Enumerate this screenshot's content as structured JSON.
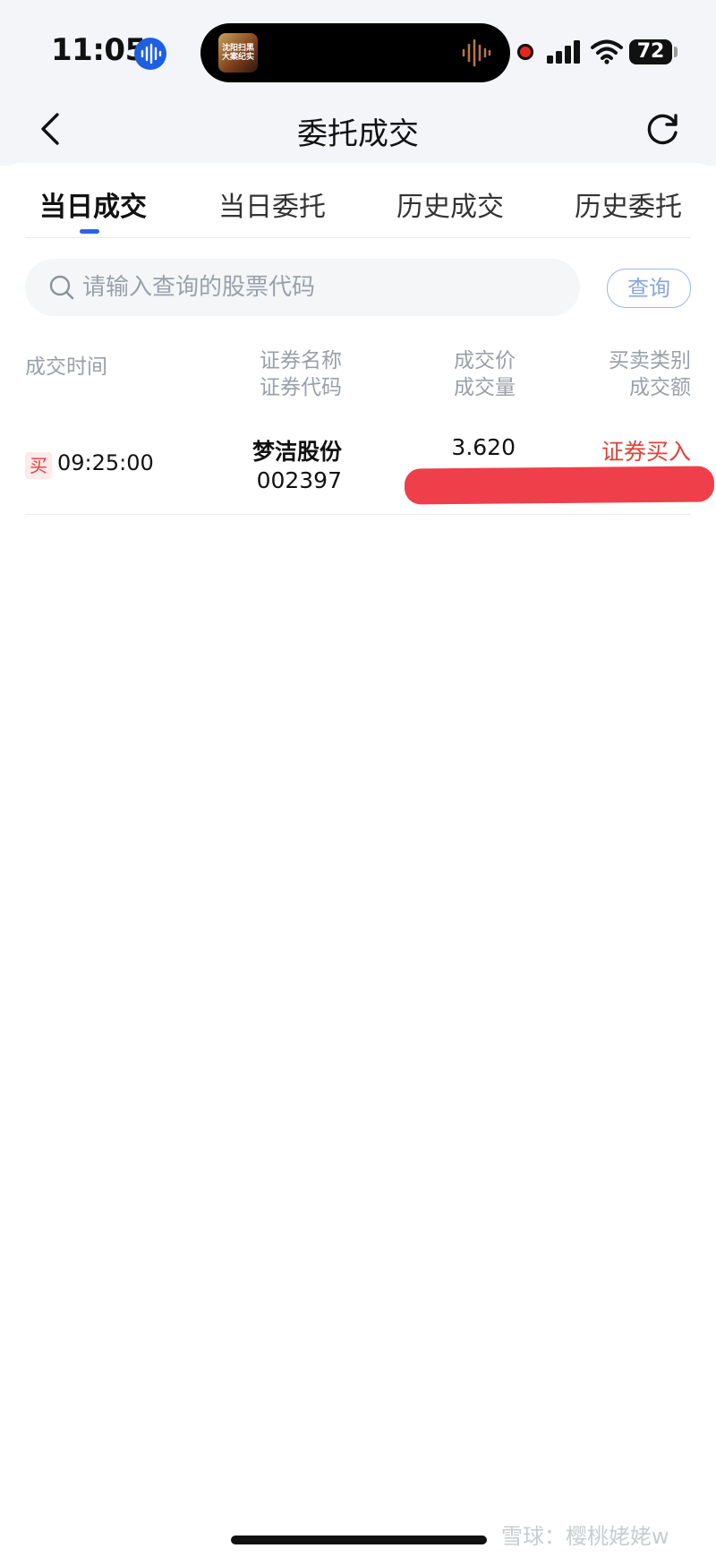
{
  "status_bar": {
    "time": "11:05",
    "battery": "72",
    "island_thumb_text": "沈阳扫黑\n大案纪实"
  },
  "nav": {
    "title": "委托成交"
  },
  "tabs": [
    {
      "label": "当日成交",
      "active": true
    },
    {
      "label": "当日委托",
      "active": false
    },
    {
      "label": "历史成交",
      "active": false
    },
    {
      "label": "历史委托",
      "active": false
    }
  ],
  "search": {
    "placeholder": "请输入查询的股票代码",
    "button_label": "查询"
  },
  "columns": {
    "time": "成交时间",
    "name": "证券名称",
    "code": "证券代码",
    "price": "成交价",
    "volume": "成交量",
    "type": "买卖类别",
    "amount": "成交额"
  },
  "trades": [
    {
      "badge": "买",
      "time": "09:25:00",
      "name": "梦洁股份",
      "code": "002397",
      "price": "3.620",
      "type": "证券买入"
    }
  ],
  "watermark": "雪球：樱桃姥姥w",
  "colors": {
    "accent_blue": "#2f63e6",
    "buy_red": "#e0403a",
    "redaction": "#ee3f4a"
  }
}
